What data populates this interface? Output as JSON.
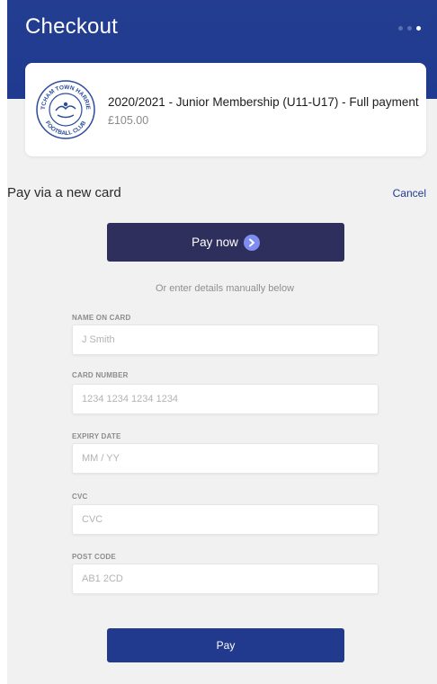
{
  "header": {
    "title": "Checkout",
    "step_dots": [
      "inactive",
      "inactive",
      "active"
    ]
  },
  "product": {
    "title": "2020/2021 - Junior Membership (U11-U17) - Full payment",
    "price": "£105.00",
    "logo_text_top": "HATCHAM TOWN HARRIERS",
    "logo_text_bottom": "FOOTBALL CLUB"
  },
  "payment": {
    "heading": "Pay via a new card",
    "cancel_label": "Cancel",
    "pay_now_label": "Pay now",
    "manual_note": "Or enter details manually below",
    "pay_label": "Pay"
  },
  "fields": {
    "name": {
      "label": "NAME ON CARD",
      "placeholder": "J Smith",
      "value": ""
    },
    "card_number": {
      "label": "CARD NUMBER",
      "placeholder": "1234 1234 1234 1234",
      "value": ""
    },
    "expiry": {
      "label": "EXPIRY DATE",
      "placeholder": "MM / YY",
      "value": ""
    },
    "cvc": {
      "label": "CVC",
      "placeholder": "CVC",
      "value": ""
    },
    "post_code": {
      "label": "POST CODE",
      "placeholder": "AB1 2CD",
      "value": ""
    }
  },
  "colors": {
    "brand_blue": "#1f3a8f",
    "pay_now_bg": "#2e2f5c",
    "page_bg": "#f1f1f1"
  },
  "icons": {
    "pay_now": "chevron-right-icon",
    "logo": "club-crest-icon"
  }
}
